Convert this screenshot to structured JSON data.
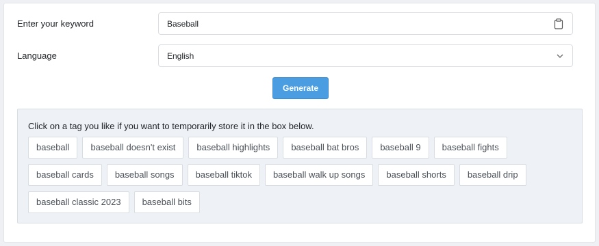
{
  "form": {
    "keyword_label": "Enter your keyword",
    "keyword_value": "Baseball",
    "language_label": "Language",
    "language_value": "English",
    "generate_label": "Generate"
  },
  "tags_panel": {
    "instructions": "Click on a tag you like if you want to temporarily store it in the box below.",
    "tags": [
      "baseball",
      "baseball doesn't exist",
      "baseball highlights",
      "baseball bat bros",
      "baseball 9",
      "baseball fights",
      "baseball cards",
      "baseball songs",
      "baseball tiktok",
      "baseball walk up songs",
      "baseball shorts",
      "baseball drip",
      "baseball classic 2023",
      "baseball bits"
    ]
  },
  "icons": {
    "keyword_field_icon": "clipboard-icon",
    "language_field_icon": "chevron-down-icon"
  },
  "colors": {
    "accent": "#4a9de1",
    "panel_background": "#eef1f6"
  }
}
